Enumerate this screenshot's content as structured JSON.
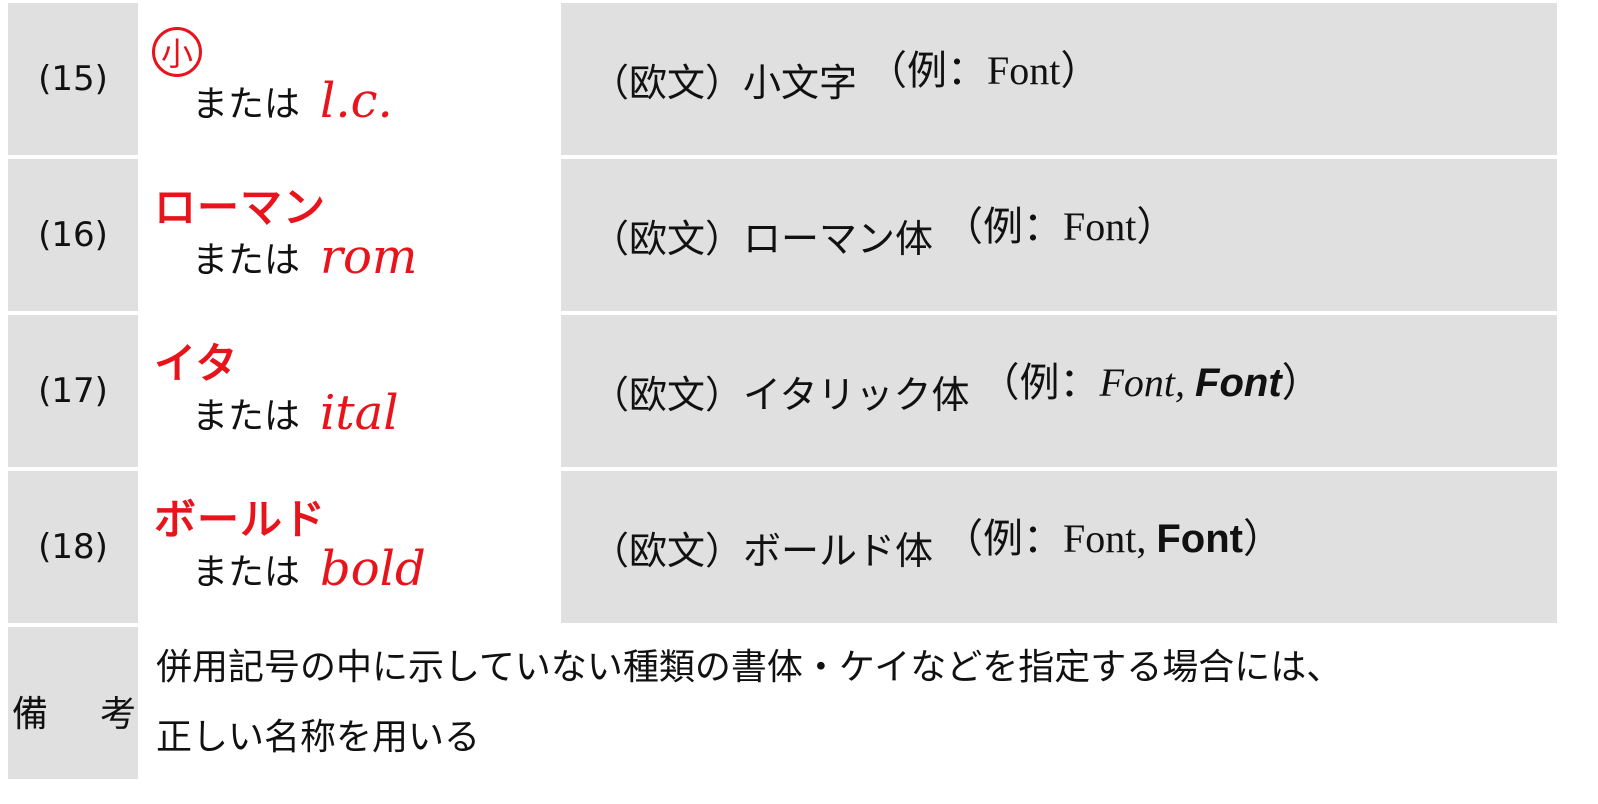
{
  "rows": [
    {
      "number": "(15)",
      "mark_top": "小",
      "mark_or": "または",
      "mark_script": "l.c.",
      "desc_label": "（欧文）小文字",
      "example_prefix": "（例：",
      "example_plain": "Font",
      "example_suffix": "）"
    },
    {
      "number": "(16)",
      "mark_top": "ローマン",
      "mark_or": "または",
      "mark_script": "rom",
      "desc_label": "（欧文）ローマン体",
      "example_prefix": "（例：",
      "example_plain": "Font",
      "example_suffix": "）"
    },
    {
      "number": "(17)",
      "mark_top": "イタ",
      "mark_or": "または",
      "mark_script": "ital",
      "desc_label": "（欧文）イタリック体",
      "example_prefix": "（例：",
      "example_italic": "Font,",
      "example_bold": "Font",
      "example_suffix": "）"
    },
    {
      "number": "(18)",
      "mark_top": "ボールド",
      "mark_or": "または",
      "mark_script": "bold",
      "desc_label": "（欧文）ボールド体",
      "example_prefix": "（例：",
      "example_plain": "Font,",
      "example_bold": "Font",
      "example_suffix": "）"
    }
  ],
  "remark": {
    "label_1": "備",
    "label_2": "考",
    "line_1": "併用記号の中に示していない種類の書体・ケイなどを指定する場合には、",
    "line_2": "正しい名称を用いる"
  },
  "colors": {
    "mark_red": "#e8141b",
    "cell_gray": "#e0e0e0"
  }
}
